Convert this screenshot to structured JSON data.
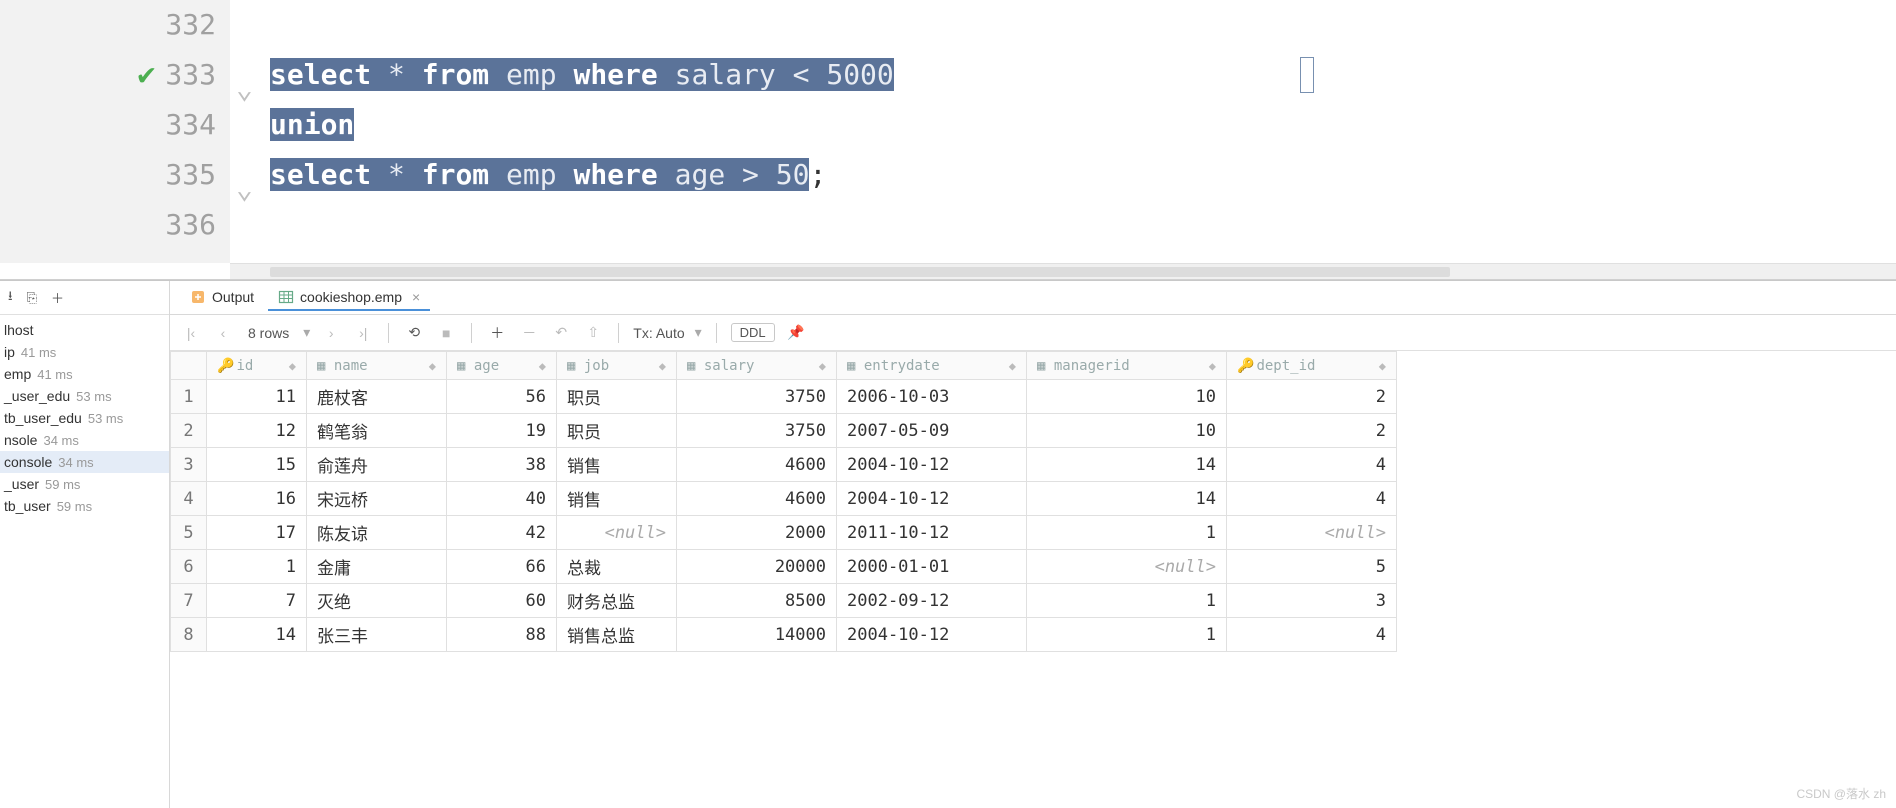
{
  "editor": {
    "lines": [
      {
        "num": "332",
        "check": false,
        "fold": false,
        "segments": []
      },
      {
        "num": "333",
        "check": true,
        "fold": true,
        "segments": [
          {
            "t": "select",
            "k": true,
            "s": true
          },
          {
            "t": " * ",
            "k": false,
            "s": true
          },
          {
            "t": "from",
            "k": true,
            "s": true
          },
          {
            "t": " emp ",
            "k": false,
            "s": true
          },
          {
            "t": "where",
            "k": true,
            "s": true
          },
          {
            "t": " salary < 5000",
            "k": false,
            "s": true
          }
        ]
      },
      {
        "num": "334",
        "check": false,
        "fold": false,
        "segments": [
          {
            "t": "union",
            "k": true,
            "s": true
          }
        ]
      },
      {
        "num": "335",
        "check": false,
        "fold": true,
        "segments": [
          {
            "t": "select",
            "k": true,
            "s": true
          },
          {
            "t": " * ",
            "k": false,
            "s": true
          },
          {
            "t": "from",
            "k": true,
            "s": true
          },
          {
            "t": " emp ",
            "k": false,
            "s": true
          },
          {
            "t": "where",
            "k": true,
            "s": true
          },
          {
            "t": " age > 50",
            "k": false,
            "s": true
          },
          {
            "t": ";",
            "k": false,
            "s": false
          }
        ]
      },
      {
        "num": "336",
        "check": false,
        "fold": false,
        "segments": []
      }
    ]
  },
  "left": {
    "host": "lhost",
    "items": [
      {
        "label": "ip",
        "time": "41 ms",
        "sel": false
      },
      {
        "label": "emp",
        "time": "41 ms",
        "sel": false
      },
      {
        "label": "_user_edu",
        "time": "53 ms",
        "sel": false
      },
      {
        "label": "tb_user_edu",
        "time": "53 ms",
        "sel": false
      },
      {
        "label": "nsole",
        "time": "34 ms",
        "sel": false
      },
      {
        "label": "console",
        "time": "34 ms",
        "sel": true
      },
      {
        "label": "_user",
        "time": "59 ms",
        "sel": false
      },
      {
        "label": "tb_user",
        "time": "59 ms",
        "sel": false
      }
    ]
  },
  "tabs": {
    "output": "Output",
    "active": "cookieshop.emp"
  },
  "toolbar": {
    "rows": "8 rows",
    "tx": "Tx: Auto",
    "ddl": "DDL"
  },
  "columns": [
    "id",
    "name",
    "age",
    "job",
    "salary",
    "entrydate",
    "managerid",
    "dept_id"
  ],
  "key_columns": [
    "id",
    "dept_id"
  ],
  "rows": [
    {
      "n": "1",
      "id": "11",
      "name": "鹿杖客",
      "age": "56",
      "job": "职员",
      "salary": "3750",
      "entrydate": "2006-10-03",
      "managerid": "10",
      "dept_id": "2"
    },
    {
      "n": "2",
      "id": "12",
      "name": "鹤笔翁",
      "age": "19",
      "job": "职员",
      "salary": "3750",
      "entrydate": "2007-05-09",
      "managerid": "10",
      "dept_id": "2"
    },
    {
      "n": "3",
      "id": "15",
      "name": "俞莲舟",
      "age": "38",
      "job": "销售",
      "salary": "4600",
      "entrydate": "2004-10-12",
      "managerid": "14",
      "dept_id": "4"
    },
    {
      "n": "4",
      "id": "16",
      "name": "宋远桥",
      "age": "40",
      "job": "销售",
      "salary": "4600",
      "entrydate": "2004-10-12",
      "managerid": "14",
      "dept_id": "4"
    },
    {
      "n": "5",
      "id": "17",
      "name": "陈友谅",
      "age": "42",
      "job": "<null>",
      "salary": "2000",
      "entrydate": "2011-10-12",
      "managerid": "1",
      "dept_id": "<null>"
    },
    {
      "n": "6",
      "id": "1",
      "name": "金庸",
      "age": "66",
      "job": "总裁",
      "salary": "20000",
      "entrydate": "2000-01-01",
      "managerid": "<null>",
      "dept_id": "5"
    },
    {
      "n": "7",
      "id": "7",
      "name": "灭绝",
      "age": "60",
      "job": "财务总监",
      "salary": "8500",
      "entrydate": "2002-09-12",
      "managerid": "1",
      "dept_id": "3"
    },
    {
      "n": "8",
      "id": "14",
      "name": "张三丰",
      "age": "88",
      "job": "销售总监",
      "salary": "14000",
      "entrydate": "2004-10-12",
      "managerid": "1",
      "dept_id": "4"
    }
  ],
  "numeric_cols": [
    "id",
    "age",
    "salary",
    "managerid",
    "dept_id"
  ],
  "watermark": "CSDN @落水 zh"
}
